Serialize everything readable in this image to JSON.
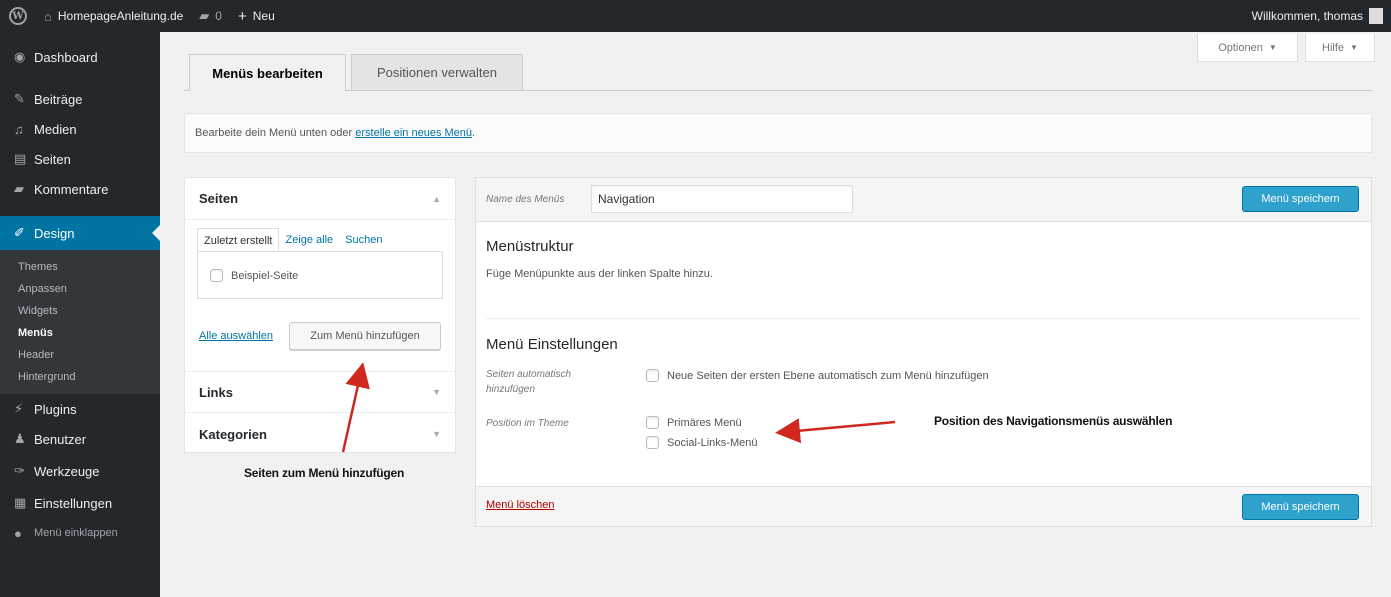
{
  "adminbar": {
    "site_name": "HomepageAnleitung.de",
    "comments_count": "0",
    "new_label": "Neu",
    "welcome": "Willkommen, thomas"
  },
  "sidebar": {
    "items": [
      {
        "label": "Dashboard",
        "icon": "dashboard-icon"
      },
      {
        "label": "Beiträge",
        "icon": "pin-icon"
      },
      {
        "label": "Medien",
        "icon": "media-icon"
      },
      {
        "label": "Seiten",
        "icon": "page-icon"
      },
      {
        "label": "Kommentare",
        "icon": "comment-icon"
      },
      {
        "label": "Design",
        "icon": "brush-icon"
      }
    ],
    "submenu": [
      "Themes",
      "Anpassen",
      "Widgets",
      "Menüs",
      "Header",
      "Hintergrund"
    ],
    "items_after": [
      {
        "label": "Plugins",
        "icon": "plugin-icon"
      },
      {
        "label": "Benutzer",
        "icon": "users-icon"
      },
      {
        "label": "Werkzeuge",
        "icon": "tools-icon"
      },
      {
        "label": "Einstellungen",
        "icon": "settings-icon"
      }
    ],
    "collapse_label": "Menü einklappen"
  },
  "screen_meta": {
    "options": "Optionen",
    "help": "Hilfe"
  },
  "tabs": {
    "edit": "Menüs bearbeiten",
    "locations": "Positionen verwalten"
  },
  "manage": {
    "text": "Bearbeite dein Menü unten oder ",
    "link": "erstelle ein neues Menü",
    "suffix": "."
  },
  "left": {
    "seiten_title": "Seiten",
    "inner_tabs": [
      "Zuletzt erstellt",
      "Zeige alle",
      "Suchen"
    ],
    "page_item": "Beispiel-Seite",
    "select_all": "Alle auswählen",
    "add_button": "Zum Menü hinzufügen",
    "links_title": "Links",
    "categories_title": "Kategorien"
  },
  "right": {
    "name_label": "Name des Menüs",
    "name_value": "Navigation",
    "save_button": "Menü speichern",
    "structure_title": "Menüstruktur",
    "structure_desc": "Füge Menüpunkte aus der linken Spalte hinzu.",
    "settings_title": "Menü Einstellungen",
    "auto_add_label_1": "Seiten automatisch",
    "auto_add_label_2": "hinzufügen",
    "auto_add_option": "Neue Seiten der ersten Ebene automatisch zum Menü hinzufügen",
    "position_label": "Position im Theme",
    "positions": [
      "Primäres Menü",
      "Social-Links-Menü"
    ],
    "delete_link": "Menü löschen"
  },
  "annotations": {
    "pages": "Seiten zum Menü hinzufügen",
    "position": "Position des Navigationsmenüs auswählen"
  },
  "colors": {
    "admin_dark": "#23282d",
    "accent": "#0074a2",
    "button_primary": "#2ea2cc",
    "arrow": "#d0281f"
  }
}
